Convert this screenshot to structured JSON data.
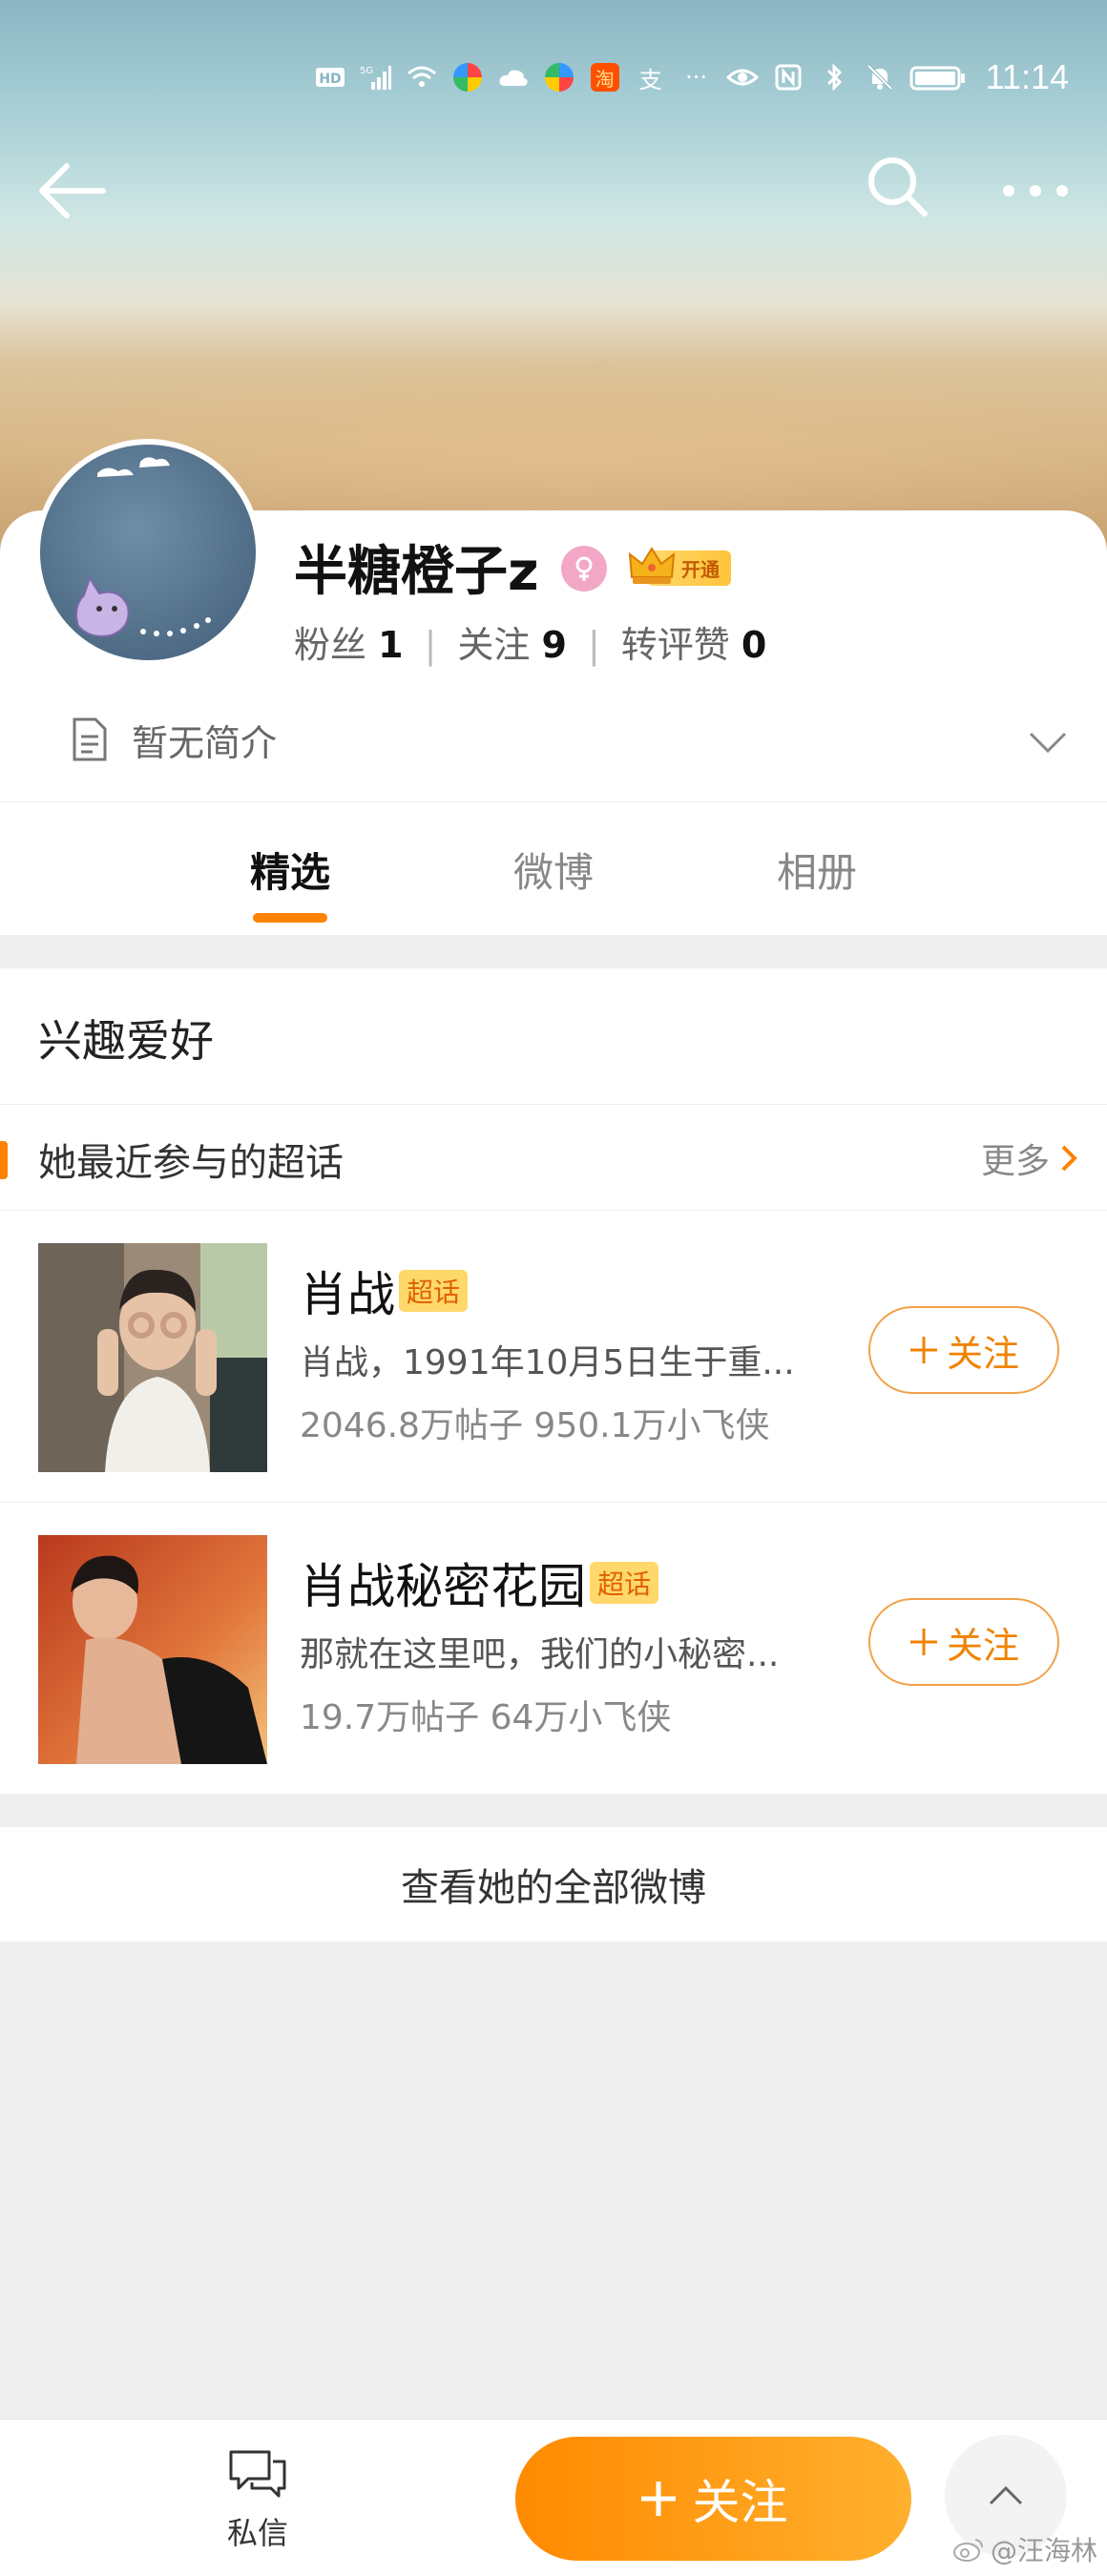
{
  "status_bar": {
    "time": "11:14",
    "icons": [
      "hd-icon",
      "signal-5g-icon",
      "wifi-icon",
      "app-icon",
      "cloud-icon",
      "app-icon",
      "taobao-icon",
      "alipay-icon",
      "more-dots-icon",
      "eye-icon",
      "nfc-icon",
      "bluetooth-icon",
      "mute-icon",
      "battery-icon"
    ],
    "taobao_glyph": "淘",
    "alipay_glyph": "支",
    "more_glyph": "···"
  },
  "profile": {
    "name": "半糖橙子z",
    "vip_label": "开通",
    "stats": [
      {
        "label": "粉丝",
        "value": "1"
      },
      {
        "label": "关注",
        "value": "9"
      },
      {
        "label": "转评赞",
        "value": "0"
      }
    ],
    "bio": "暂无简介"
  },
  "tabs": [
    {
      "label": "精选",
      "active": true
    },
    {
      "label": "微博",
      "active": false
    },
    {
      "label": "相册",
      "active": false
    }
  ],
  "interests": {
    "title": "兴趣爱好",
    "subsection_title": "她最近参与的超话",
    "more_label": "更多",
    "topics": [
      {
        "name": "肖战",
        "badge": "超话",
        "description": "肖战，1991年10月5日生于重...",
        "stats": "2046.8万帖子 950.1万小飞侠",
        "follow_label": "关注"
      },
      {
        "name": "肖战秘密花园",
        "badge": "超话",
        "description": "那就在这里吧，我们的小秘密...",
        "stats": "19.7万帖子 64万小飞侠",
        "follow_label": "关注"
      }
    ]
  },
  "view_all_label": "查看她的全部微博",
  "bottom_bar": {
    "dm_label": "私信",
    "follow_label": "关注"
  },
  "watermark": "@汪海林",
  "colors": {
    "accent": "#ff8200",
    "vip_gold": "#ffc43a",
    "gender_pink": "#f2a7c6"
  }
}
